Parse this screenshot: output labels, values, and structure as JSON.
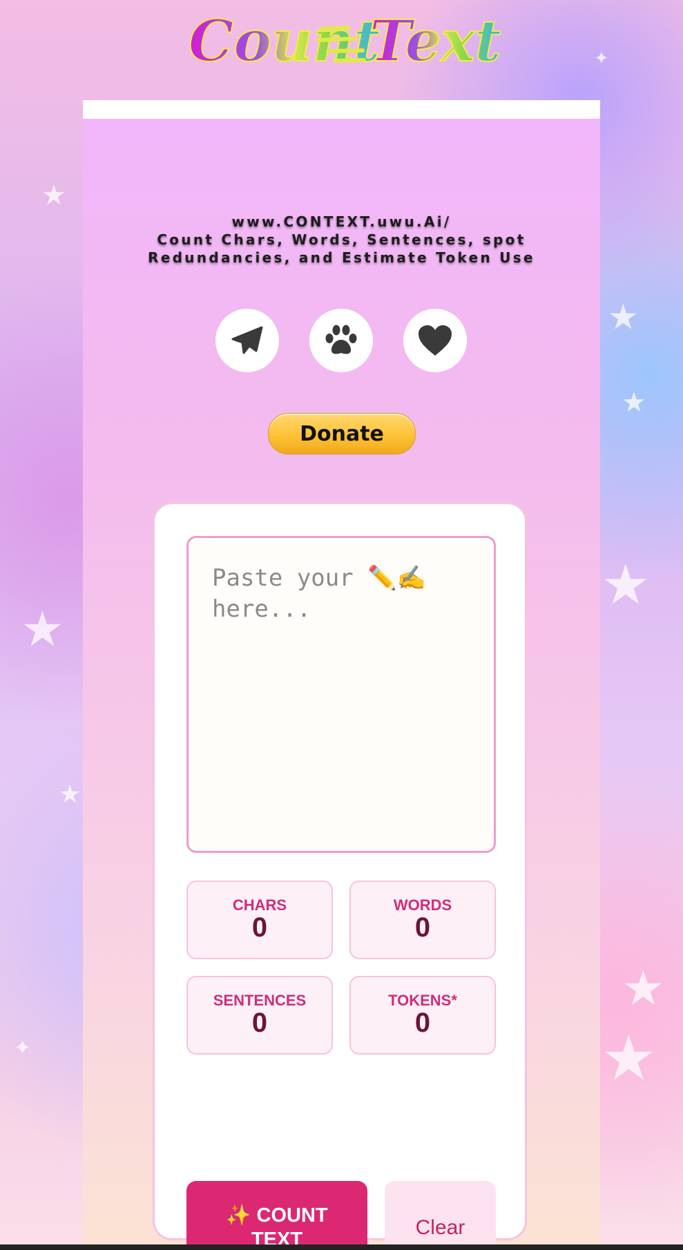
{
  "logo": {
    "text_left": "Count",
    "text_right": "Text"
  },
  "tagline": {
    "line1": "www.CONTEXT.uwu.Ai/",
    "line2": "Count Chars, Words, Sentences, spot",
    "line3": "Redundancies, and Estimate Token Use"
  },
  "social": [
    {
      "icon": "paper-plane-icon"
    },
    {
      "icon": "paw-icon"
    },
    {
      "icon": "heart-icon"
    }
  ],
  "donate": {
    "label": "Donate"
  },
  "input": {
    "placeholder": "Paste your ✏️✍️ here...",
    "value": ""
  },
  "stats": {
    "chars": {
      "label": "CHARS",
      "value": "0"
    },
    "words": {
      "label": "WORDS",
      "value": "0"
    },
    "sentences": {
      "label": "SENTENCES",
      "value": "0"
    },
    "tokens": {
      "label": "TOKENS*",
      "value": "0"
    }
  },
  "actions": {
    "count_label": "✨ COUNT TEXT",
    "clear_label": "Clear"
  },
  "colors": {
    "accent": "#dc2873",
    "stat_label": "#cf2d7a",
    "stat_value": "#6e1438",
    "input_border": "#f09ccb",
    "donate": "#ffc236"
  }
}
